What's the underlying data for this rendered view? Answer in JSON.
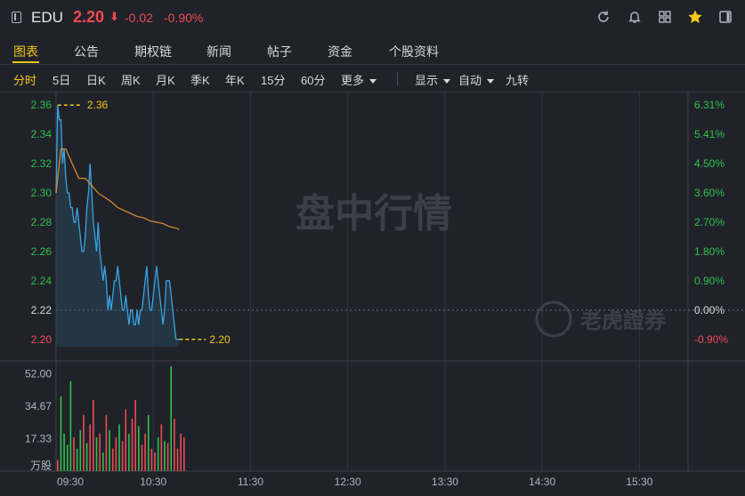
{
  "header": {
    "ticker": "EDU",
    "price": "2.20",
    "price_arrow": "⬇",
    "change": "-0.02",
    "change_pct": "-0.90%",
    "icons": [
      "refresh-icon",
      "bell-icon",
      "grid-icon",
      "star-icon",
      "sidebar-toggle-icon"
    ]
  },
  "tabs": [
    {
      "label": "图表",
      "active": true
    },
    {
      "label": "公告"
    },
    {
      "label": "期权链"
    },
    {
      "label": "新闻"
    },
    {
      "label": "帖子"
    },
    {
      "label": "资金"
    },
    {
      "label": "个股资料"
    }
  ],
  "periods": [
    "分时",
    "5日",
    "日K",
    "周K",
    "月K",
    "季K",
    "年K",
    "15分",
    "60分"
  ],
  "more_label": "更多",
  "options": {
    "display": "显示",
    "auto": "自动",
    "adjust": "九转"
  },
  "watermark": "盘中行情",
  "brand": "老虎證券",
  "colors": {
    "up": "#30c04e",
    "down": "#f04a55",
    "accent": "#f5c518",
    "line": "#3aa3e3",
    "avg": "#e08a2c"
  },
  "chart_data": {
    "type": "line",
    "price_axis": {
      "ticks": [
        "2.36",
        "2.34",
        "2.32",
        "2.30",
        "2.28",
        "2.26",
        "2.24",
        "2.22",
        "2.20"
      ],
      "tick_values": [
        2.36,
        2.34,
        2.32,
        2.3,
        2.28,
        2.26,
        2.24,
        2.22,
        2.2
      ],
      "ylim": [
        2.195,
        2.365
      ]
    },
    "pct_axis": {
      "ticks": [
        "6.31%",
        "5.41%",
        "4.50%",
        "3.60%",
        "2.70%",
        "1.80%",
        "0.90%",
        "0.00%",
        "-0.90%"
      ]
    },
    "prev_close": 2.22,
    "x_ticks": [
      "09:30",
      "10:30",
      "11:30",
      "12:30",
      "13:30",
      "14:30",
      "15:30"
    ],
    "x_range_minutes": [
      0,
      390
    ],
    "high_label": "2.36",
    "low_label": "2.20",
    "price_series": {
      "name": "price",
      "x": [
        0,
        1,
        2,
        3,
        4,
        5,
        6,
        7,
        8,
        9,
        10,
        11,
        12,
        13,
        14,
        15,
        16,
        17,
        18,
        19,
        20,
        21,
        22,
        23,
        24,
        25,
        26,
        27,
        28,
        29,
        30,
        31,
        32,
        33,
        34,
        35,
        36,
        37,
        38,
        39,
        40,
        41,
        42,
        43,
        44,
        45,
        46,
        47,
        48,
        49,
        50,
        51,
        52,
        53,
        54,
        55,
        56,
        57,
        58,
        59,
        60,
        61,
        62,
        63,
        64,
        65,
        66,
        67,
        68,
        69,
        70,
        71,
        72,
        73,
        74,
        75,
        76
      ],
      "values": [
        2.3,
        2.36,
        2.35,
        2.35,
        2.32,
        2.33,
        2.31,
        2.3,
        2.3,
        2.29,
        2.29,
        2.28,
        2.28,
        2.29,
        2.28,
        2.27,
        2.26,
        2.26,
        2.27,
        2.29,
        2.3,
        2.32,
        2.3,
        2.28,
        2.27,
        2.26,
        2.28,
        2.26,
        2.25,
        2.24,
        2.25,
        2.24,
        2.22,
        2.23,
        2.22,
        2.23,
        2.24,
        2.24,
        2.25,
        2.24,
        2.23,
        2.22,
        2.22,
        2.23,
        2.22,
        2.21,
        2.22,
        2.22,
        2.21,
        2.21,
        2.22,
        2.21,
        2.22,
        2.22,
        2.23,
        2.24,
        2.25,
        2.23,
        2.22,
        2.22,
        2.23,
        2.24,
        2.25,
        2.24,
        2.23,
        2.22,
        2.21,
        2.22,
        2.24,
        2.24,
        2.24,
        2.23,
        2.22,
        2.21,
        2.2,
        2.2,
        2.2
      ]
    },
    "avg_series": {
      "name": "avg",
      "x": [
        0,
        3,
        6,
        10,
        14,
        18,
        22,
        26,
        30,
        34,
        38,
        42,
        46,
        50,
        54,
        58,
        62,
        66,
        70,
        74,
        76
      ],
      "values": [
        2.3,
        2.33,
        2.33,
        2.32,
        2.31,
        2.31,
        2.305,
        2.3,
        2.297,
        2.294,
        2.29,
        2.288,
        2.286,
        2.284,
        2.283,
        2.281,
        2.28,
        2.279,
        2.277,
        2.276,
        2.275
      ]
    },
    "volume_axis": {
      "ticks": [
        "52.00",
        "34.67",
        "17.33"
      ],
      "unit": "万股",
      "ylim": [
        0,
        57
      ]
    },
    "volume_x_step": 2,
    "volume": [
      6,
      40,
      20,
      14,
      48,
      18,
      12,
      22,
      30,
      15,
      25,
      38,
      18,
      20,
      10,
      30,
      22,
      12,
      18,
      25,
      16,
      33,
      20,
      28,
      38,
      24,
      14,
      20,
      30,
      12,
      10,
      18,
      25,
      16,
      15,
      56,
      28,
      12,
      20,
      18
    ],
    "volume_up": [
      false,
      true,
      true,
      true,
      true,
      false,
      true,
      true,
      false,
      true,
      false,
      false,
      true,
      false,
      true,
      false,
      true,
      false,
      false,
      true,
      false,
      false,
      true,
      false,
      false,
      true,
      false,
      false,
      true,
      false,
      false,
      true,
      false,
      true,
      false,
      true,
      false,
      false,
      false,
      false
    ]
  }
}
